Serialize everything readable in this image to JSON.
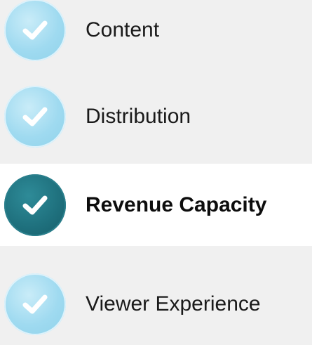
{
  "checklist": {
    "items": [
      {
        "label": "Content",
        "state": "completed",
        "icon": "check-icon"
      },
      {
        "label": "Distribution",
        "state": "completed",
        "icon": "check-icon"
      },
      {
        "label": "Revenue Capacity",
        "state": "active",
        "icon": "check-icon"
      },
      {
        "label": "Viewer Experience",
        "state": "completed",
        "icon": "check-icon"
      }
    ]
  },
  "colors": {
    "background": "#f0f0f0",
    "active_row_background": "#ffffff",
    "check_light": "#9fdaf0",
    "check_dark": "#1e6f7c",
    "label_text": "#1a1a1a"
  }
}
